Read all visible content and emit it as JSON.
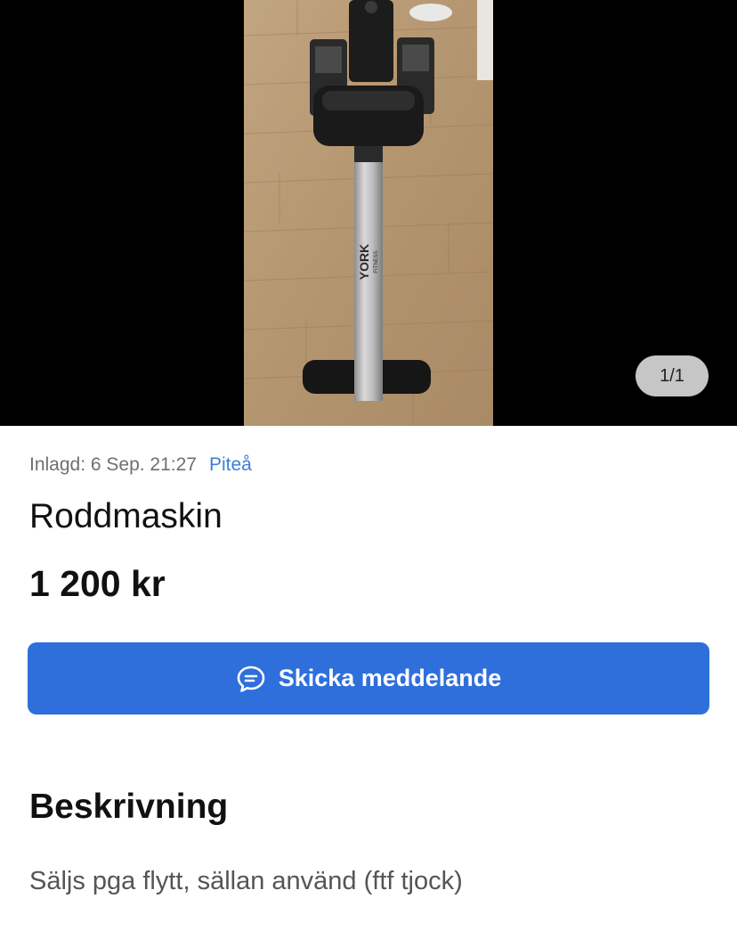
{
  "gallery": {
    "counter": "1/1",
    "photo_brand": "YORK",
    "photo_brand_sub": "FITNESS"
  },
  "listing": {
    "posted_label": "Inlagd: 6 Sep. 21:27",
    "location": "Piteå",
    "title": "Roddmaskin",
    "price": "1 200 kr",
    "send_message_label": "Skicka meddelande",
    "description_heading": "Beskrivning",
    "description": "Säljs pga flytt, sällan använd (ftf tjock)"
  },
  "icons": {
    "send_message": "chat-bubble-icon"
  },
  "colors": {
    "accent": "#2f6fdc",
    "link": "#3a7fd8",
    "muted_text": "#6f6f6f"
  }
}
